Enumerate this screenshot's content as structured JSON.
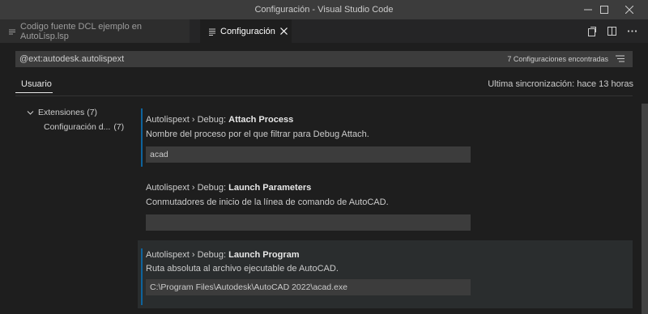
{
  "window": {
    "title": "Configuración - Visual Studio Code"
  },
  "tabs": [
    {
      "label": "Codigo fuente DCL ejemplo en AutoLisp.lsp",
      "active": false
    },
    {
      "label": "Configuración",
      "active": true
    }
  ],
  "search": {
    "query": "@ext:autodesk.autolispext",
    "result_count": "7 Configuraciones encontradas"
  },
  "scope": {
    "active_tab": "Usuario",
    "sync_status": "Ultima sincronización: hace 13 horas"
  },
  "toc": {
    "group_label": "Extensiones",
    "group_count": "(7)",
    "item_label": "Configuración d...",
    "item_count": "(7)"
  },
  "settings": [
    {
      "category": "Autolispext › Debug: ",
      "name": "Attach Process",
      "description": "Nombre del proceso por el que filtrar para Debug Attach.",
      "value": "acad"
    },
    {
      "category": "Autolispext › Debug: ",
      "name": "Launch Parameters",
      "description": "Conmutadores de inicio de la línea de comando de AutoCAD.",
      "value": ""
    },
    {
      "category": "Autolispext › Debug: ",
      "name": "Launch Program",
      "description": "Ruta absoluta al archivo ejecutable de AutoCAD.",
      "value": "C:\\Program Files\\Autodesk\\AutoCAD 2022\\acad.exe"
    }
  ],
  "colors": {
    "accent": "#0e639c",
    "background": "#1e1e1e",
    "titlebar": "#3c3c3c"
  }
}
